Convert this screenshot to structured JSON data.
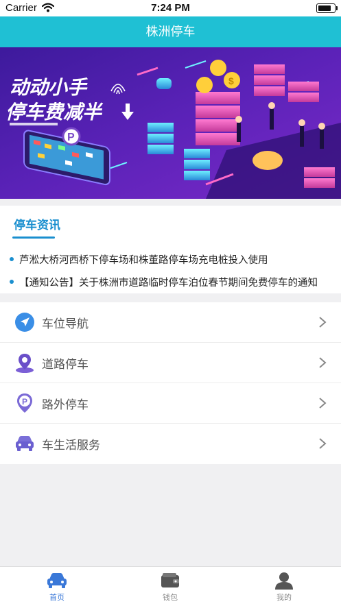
{
  "status_bar": {
    "carrier": "Carrier",
    "time": "7:24 PM"
  },
  "header": {
    "title": "株洲停车"
  },
  "banner": {
    "headline_line1": "动动小手",
    "headline_line2": "停车费减半",
    "dots_count": 4,
    "active_dot": 3
  },
  "news": {
    "title": "停车资讯",
    "items": [
      "芦淞大桥河西桥下停车场和株董路停车场充电桩投入使用",
      "【通知公告】关于株洲市道路临时停车泊位春节期间免费停车的通知"
    ]
  },
  "menu": {
    "items": [
      {
        "label": "车位导航",
        "icon": "navigation-arrow-icon"
      },
      {
        "label": "道路停车",
        "icon": "location-pin-icon"
      },
      {
        "label": "路外停车",
        "icon": "parking-p-icon"
      },
      {
        "label": "车生活服务",
        "icon": "car-icon"
      }
    ]
  },
  "tabbar": {
    "items": [
      {
        "label": "首页",
        "icon": "car-home-icon",
        "active": true
      },
      {
        "label": "钱包",
        "icon": "wallet-icon",
        "active": false
      },
      {
        "label": "我的",
        "icon": "user-icon",
        "active": false
      }
    ]
  },
  "colors": {
    "accent": "#1fc0d4",
    "link_blue": "#1a8fcf",
    "tab_active": "#3a78d8",
    "banner_bg": "#4a1fa0"
  }
}
